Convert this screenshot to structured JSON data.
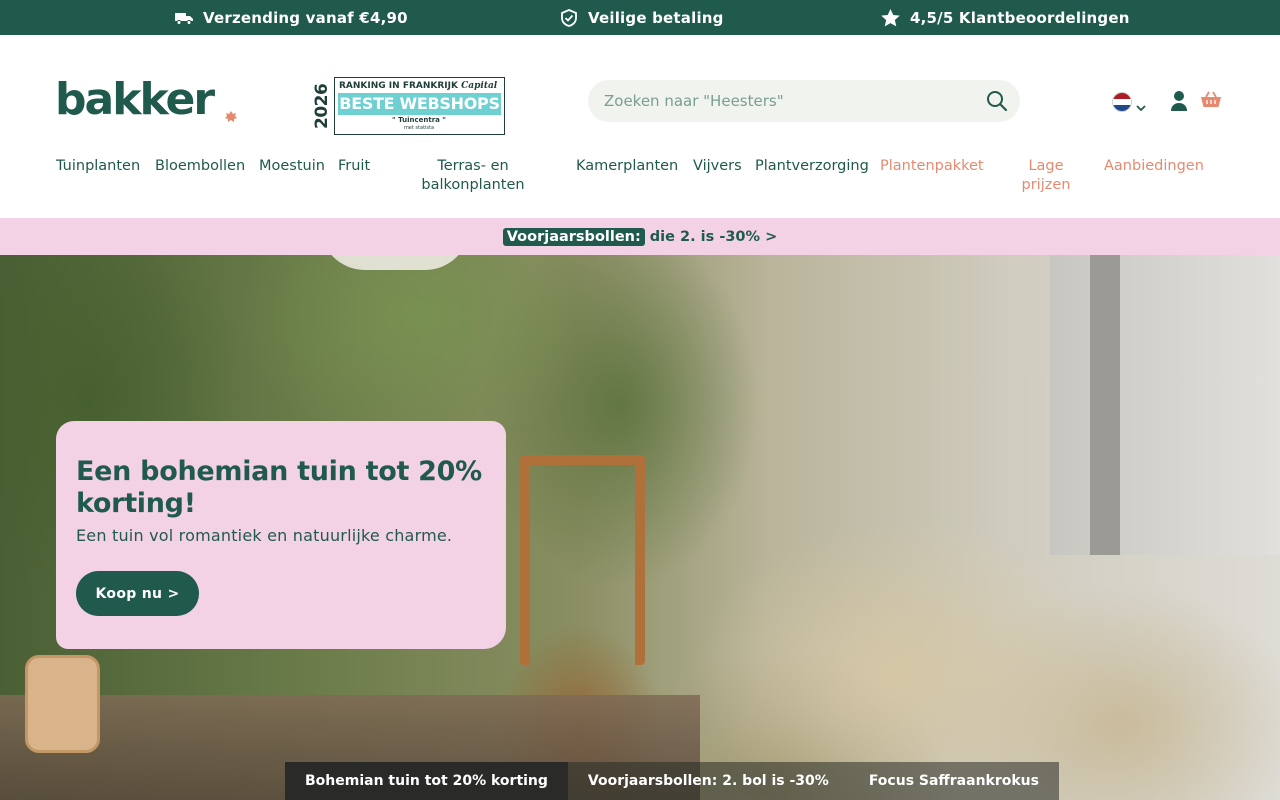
{
  "topbar": {
    "shipping": "Verzending vanaf €4,90",
    "payment": "Veilige betaling",
    "rating": "4,5/5 Klantbeoordelingen"
  },
  "header": {
    "logo": "bakker",
    "award": {
      "year": "2026",
      "line1": "RANKING IN FRANKRIJK",
      "brand": "Capital",
      "banner": "BESTE WEBSHOPS",
      "category": "\" Tuincentra \"",
      "source": "met statista"
    },
    "search": {
      "placeholder": "Zoeken naar \"Heesters\""
    },
    "icons": [
      "truck-icon",
      "shield-check-icon",
      "star-icon",
      "search-icon",
      "flag-nl-icon",
      "chevron-down-icon",
      "user-icon",
      "basket-icon",
      "leaf-icon"
    ]
  },
  "nav": {
    "items": [
      {
        "label": "Tuinplanten"
      },
      {
        "label": "Bloembollen"
      },
      {
        "label": "Moestuin"
      },
      {
        "label": "Fruit"
      },
      {
        "label": "Terras- en"
      },
      {
        "label": "balkonplanten"
      },
      {
        "label": "Kamerplanten"
      },
      {
        "label": "Vijvers"
      },
      {
        "label": "Plantverzorging"
      },
      {
        "label": "Plantenpakket"
      },
      {
        "label": "Lage"
      },
      {
        "label": "prijzen"
      },
      {
        "label": "Aanbiedingen"
      }
    ],
    "accent_color": "#e58a6f"
  },
  "promo": {
    "tag": "Voorjaarsbollen:",
    "text": "die 2. is -30% >"
  },
  "hero": {
    "title": "Een bohemian tuin tot 20% korting!",
    "subtitle": "Een tuin vol romantiek en natuurlijke charme.",
    "cta": "Koop nu >",
    "tabs": [
      {
        "label": "Bohemian tuin tot 20% korting",
        "active": true
      },
      {
        "label": "Voorjaarsbollen: 2. bol is -30%",
        "active": false
      },
      {
        "label": "Focus Saffraankrokus",
        "active": false
      }
    ]
  },
  "colors": {
    "brand": "#1f5a4c",
    "pink": "#f4d2e6",
    "accent": "#e58a6f"
  }
}
